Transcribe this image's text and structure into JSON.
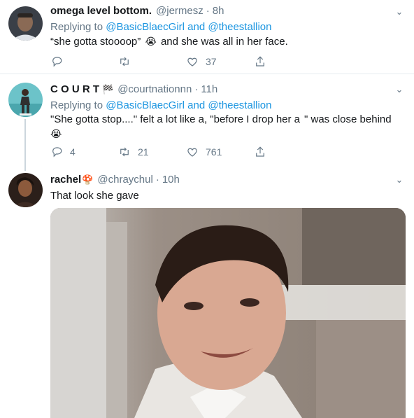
{
  "tweets": [
    {
      "display_name": "omega level bottom.",
      "handle": "@jermesz",
      "separator": "·",
      "time": "8h",
      "replying_prefix": "Replying to ",
      "replying_user1": "@BasicBlaecGirl",
      "replying_and": " and ",
      "replying_user2": "@theestallion",
      "text_before": "“she gotta stoooop”",
      "emoji": "😭",
      "text_after": "and she was all in her face.",
      "replies": "",
      "retweets": "",
      "likes": "37"
    },
    {
      "display_name": "C O U R T",
      "flag_icon": "🏁",
      "handle": "@courtnationnn",
      "separator": "·",
      "time": "11h",
      "replying_prefix": "Replying to ",
      "replying_user1": "@BasicBlaecGirl",
      "replying_and": " and ",
      "replying_user2": "@theestallion",
      "text_before": "\"She gotta stop....\" felt a lot like a, \"before I drop her a  \" was close behind",
      "emoji": "😭",
      "replies": "4",
      "retweets": "21",
      "likes": "761"
    },
    {
      "display_name": "rachel",
      "mushroom_icon": "🍄",
      "handle": "@chraychul",
      "separator": "·",
      "time": "10h",
      "text": "That look she gave"
    }
  ],
  "colors": {
    "link": "#1b95e0",
    "secondary_text": "#657786",
    "divider": "#e6ecf0"
  }
}
